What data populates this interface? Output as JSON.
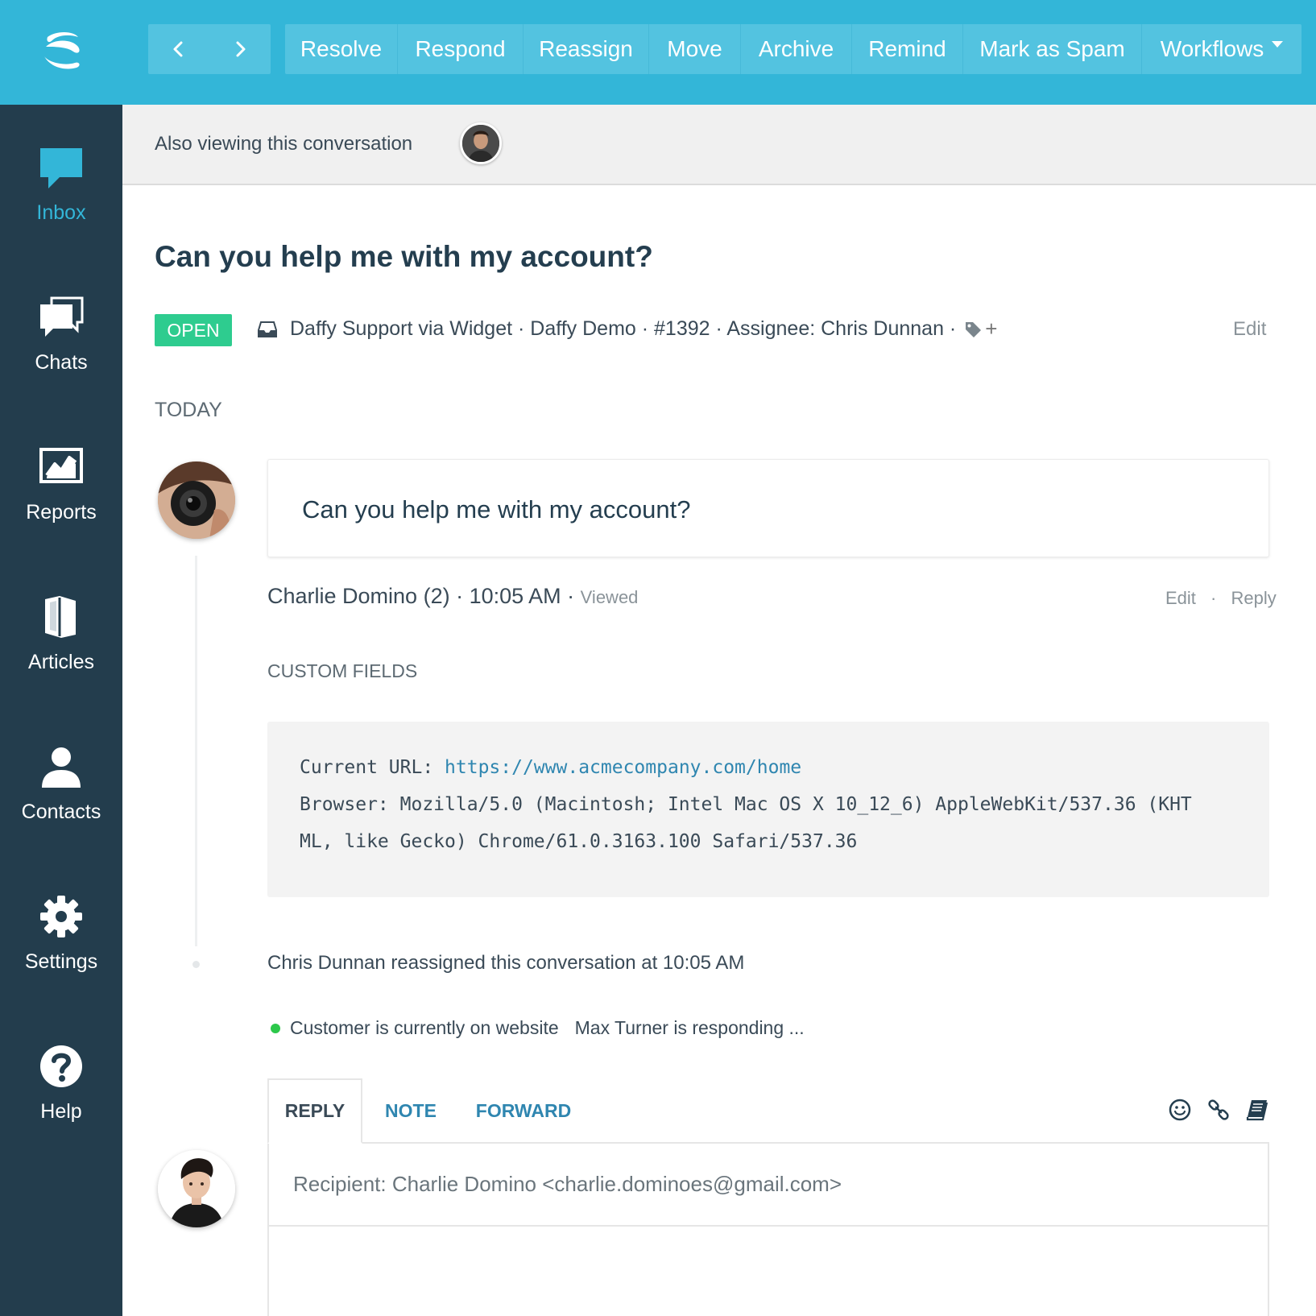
{
  "toolbar": {
    "nav": [
      {
        "name": "prev-conversation-button",
        "icon": "chevron-left-icon"
      },
      {
        "name": "next-conversation-button",
        "icon": "chevron-right-icon"
      }
    ],
    "actions": [
      {
        "name": "resolve-button",
        "label": "Resolve"
      },
      {
        "name": "respond-button",
        "label": "Respond"
      },
      {
        "name": "reassign-button",
        "label": "Reassign"
      },
      {
        "name": "move-button",
        "label": "Move"
      },
      {
        "name": "archive-button",
        "label": "Archive"
      },
      {
        "name": "remind-button",
        "label": "Remind"
      },
      {
        "name": "mark-as-spam-button",
        "label": "Mark as Spam"
      },
      {
        "name": "workflows-dropdown",
        "label": "Workflows"
      }
    ],
    "brand_color": "#33b6d8"
  },
  "sidebar": {
    "items": [
      {
        "name": "sidebar-item-inbox",
        "label": "Inbox",
        "icon": "inbox-icon",
        "active": true
      },
      {
        "name": "sidebar-item-chats",
        "label": "Chats",
        "icon": "chats-icon"
      },
      {
        "name": "sidebar-item-reports",
        "label": "Reports",
        "icon": "reports-icon"
      },
      {
        "name": "sidebar-item-articles",
        "label": "Articles",
        "icon": "articles-icon"
      },
      {
        "name": "sidebar-item-contacts",
        "label": "Contacts",
        "icon": "contacts-icon"
      },
      {
        "name": "sidebar-item-settings",
        "label": "Settings",
        "icon": "gear-icon"
      },
      {
        "name": "sidebar-item-help",
        "label": "Help",
        "icon": "help-icon"
      }
    ],
    "background": "#233d4d"
  },
  "viewing": {
    "text": "Also viewing this conversation"
  },
  "conversation": {
    "title": "Can you help me with my account?",
    "status": "OPEN",
    "meta": "Daffy Support via Widget · Daffy Demo · #1392 · Assignee: Chris Dunnan ·",
    "tag_add": "+",
    "edit": "Edit",
    "day_label": "TODAY",
    "message": {
      "text": "Can you help me with my account?",
      "author": "Charlie Domino (2) · 10:05 AM ·",
      "viewed": "Viewed",
      "edit": "Edit",
      "sep": "·",
      "reply": "Reply"
    },
    "custom_fields": {
      "title": "CUSTOM FIELDS",
      "url_label": "Current URL:",
      "url": "https://www.acmecompany.com/home",
      "browser_line1": "Browser: Mozilla/5.0 (Macintosh; Intel Mac OS X 10_12_6) AppleWebKit/537.36 (KHT",
      "browser_line2": "ML, like Gecko) Chrome/61.0.3163.100 Safari/537.36"
    },
    "event": "Chris Dunnan reassigned this conversation at 10:05 AM",
    "presence": "Customer is currently on website",
    "responding": "Max Turner is responding ..."
  },
  "composer": {
    "tabs": [
      {
        "name": "tab-reply",
        "label": "REPLY",
        "active": true
      },
      {
        "name": "tab-note",
        "label": "NOTE"
      },
      {
        "name": "tab-forward",
        "label": "FORWARD"
      }
    ],
    "tools": [
      "emoji-icon",
      "link-icon",
      "knowledge-book-icon"
    ],
    "recipient": "Recipient: Charlie Domino <charlie.dominoes@gmail.com>"
  },
  "colors": {
    "open_badge": "#2ecc8f",
    "link": "#2f86b0",
    "online_dot": "#2cc84b"
  }
}
